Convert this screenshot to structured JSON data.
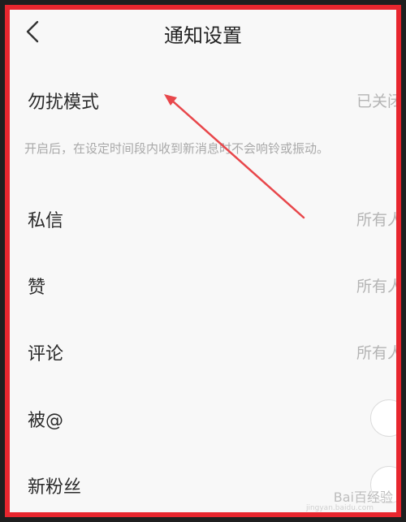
{
  "header": {
    "title": "通知设置",
    "back_icon": "chevron-left-icon"
  },
  "dnd": {
    "label": "勿扰模式",
    "value": "已关闭"
  },
  "hint": "开启后，在设定时间段内收到新消息时不会响铃或振动。",
  "rows": [
    {
      "label": "私信",
      "value": "所有人"
    },
    {
      "label": "赞",
      "value": "所有人"
    },
    {
      "label": "评论",
      "value": "所有人"
    },
    {
      "label": "被@",
      "value": ""
    },
    {
      "label": "新粉丝",
      "value": ""
    }
  ],
  "colors": {
    "frame_border": "#e8262e",
    "arrow": "#e8474b"
  },
  "watermark": {
    "text": "Bai百经验",
    "url": "jingyan.baidu.com"
  }
}
